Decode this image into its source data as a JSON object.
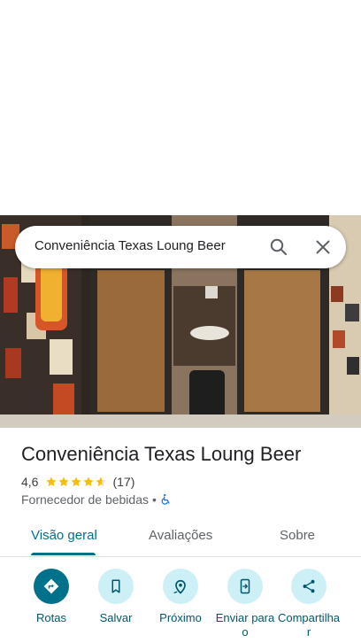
{
  "search": {
    "query": "Conveniência Texas Loung Beer"
  },
  "place": {
    "name": "Conveniência Texas Loung Beer",
    "rating": "4,6",
    "rating_value": 4.6,
    "review_count": "(17)",
    "category": "Fornecedor de bebidas",
    "separator": "•"
  },
  "tabs": [
    {
      "label": "Visão geral",
      "active": true
    },
    {
      "label": "Avaliações",
      "active": false
    },
    {
      "label": "Sobre",
      "active": false
    }
  ],
  "actions": [
    {
      "label": "Rotas",
      "icon": "directions-icon"
    },
    {
      "label": "Salvar",
      "icon": "bookmark-icon"
    },
    {
      "label": "Próximo",
      "icon": "nearby-icon"
    },
    {
      "label": "Enviar para o",
      "icon": "send-to-phone-icon"
    },
    {
      "label": "Compartilhar",
      "icon": "share-icon"
    }
  ],
  "colors": {
    "accent": "#00718a",
    "star": "#fbbc04",
    "action_bg": "#cdeff6"
  }
}
